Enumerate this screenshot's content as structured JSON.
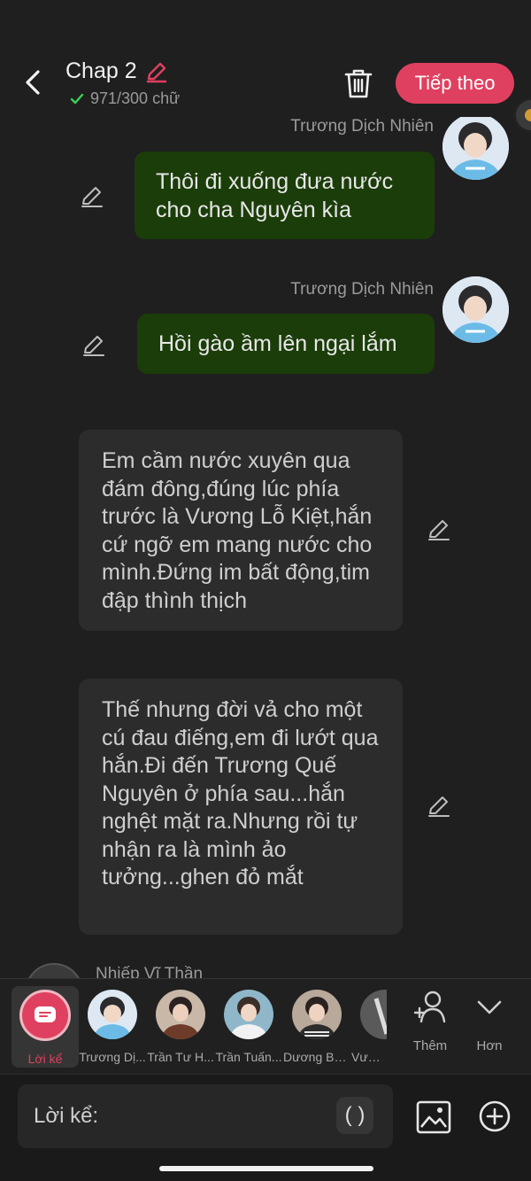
{
  "header": {
    "title": "Chap 2",
    "word_count": "971/300 chữ",
    "next_label": "Tiếp theo"
  },
  "messages": [
    {
      "speaker": "Trương Dịch Nhiên",
      "text": "Thôi đi xuống đưa nước cho cha Nguyên kìa"
    },
    {
      "speaker": "Trương Dịch Nhiên",
      "text": "Hồi gào ầm lên ngại lắm"
    }
  ],
  "narrations": [
    {
      "text": "Em cầm nước xuyên qua đám đông,đúng lúc phía trước là Vương Lỗ Kiệt,hắn cứ ngỡ em mang nước cho mình.Đứng im bất động,tim đập thình thịch"
    },
    {
      "text": "Thế nhưng đời vả cho một cú đau điếng,em đi lướt qua hắn.Đi đến Trương Quế Nguyên ở phía sau...hắn nghệt mặt ra.Nhưng rồi tự nhận ra là mình ảo tưởng...ghen đỏ mắt"
    }
  ],
  "partial_speaker": "Nhiếp Vĩ Thần",
  "characters": [
    {
      "label": "Lời kể"
    },
    {
      "label": "Trương Dị..."
    },
    {
      "label": "Trần Tư H..."
    },
    {
      "label": "Trần Tuấn..."
    },
    {
      "label": "Dương Bá..."
    },
    {
      "label": "Vương"
    }
  ],
  "tools": {
    "add_label": "Thêm",
    "more_label": "Hơn"
  },
  "input": {
    "label": "Lời kể:",
    "paren": "( )"
  },
  "colors": {
    "accent": "#e0405f",
    "bubble_green": "#1b3d0a",
    "bubble_dark": "#2c2c2c",
    "background": "#1f1f1f"
  }
}
